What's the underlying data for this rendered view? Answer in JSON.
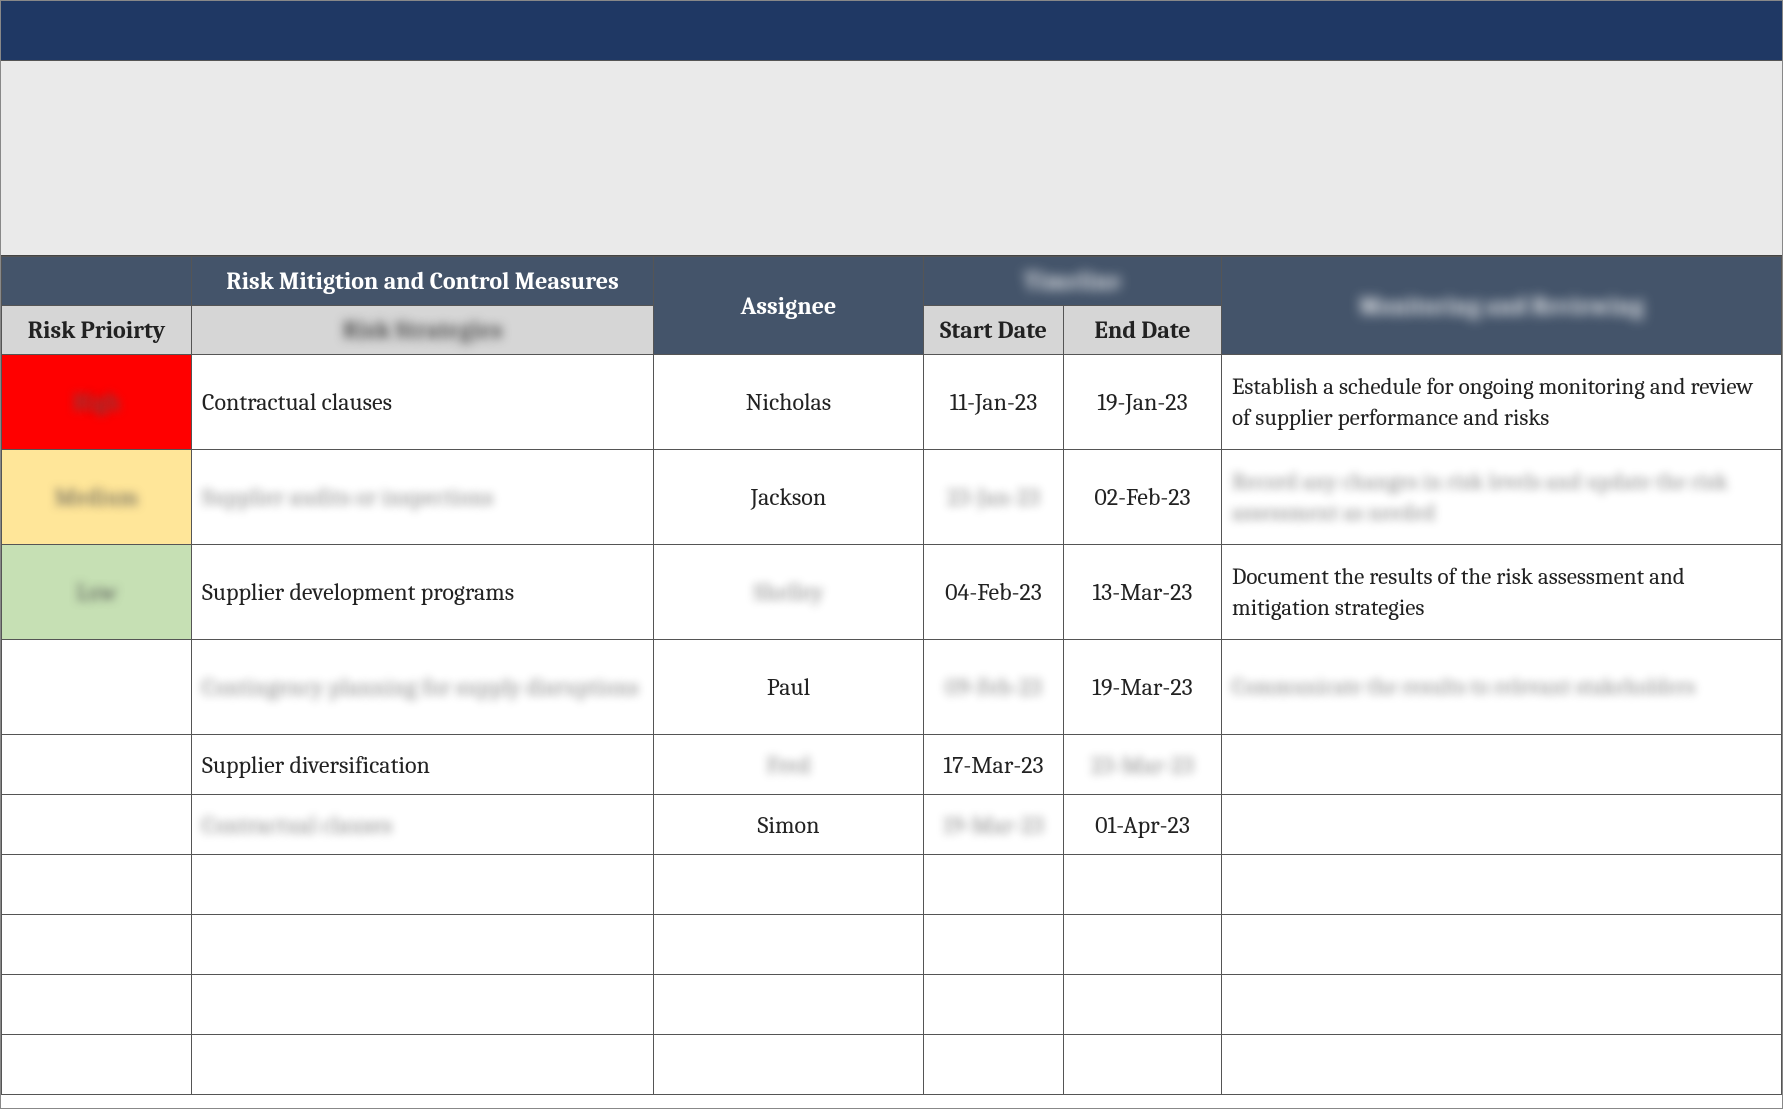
{
  "headers": {
    "risk_mitigation": "Risk Mitigtion and Control Measures",
    "risk_priority": "Risk Prioirty",
    "risk_strategies": "Risk Strategies",
    "assignee": "Assignee",
    "timeline": "Timeline",
    "start_date": "Start Date",
    "end_date": "End Date",
    "monitoring": "Monitoring and Reviewing"
  },
  "rows": [
    {
      "priority": "High",
      "strategy": "Contractual clauses",
      "assignee": "Nicholas",
      "start": "11-Jan-23",
      "end": "19-Jan-23",
      "monitor": "Establish a schedule for ongoing monitoring and review of supplier performance and risks"
    },
    {
      "priority": "Medium",
      "strategy": "Supplier audits or inspections",
      "assignee": "Jackson",
      "start": "23-Jan-23",
      "end": "02-Feb-23",
      "monitor": "Record any changes in risk levels and update the risk assessment as needed"
    },
    {
      "priority": "Low",
      "strategy": "Supplier development programs",
      "assignee": "Shelley",
      "start": "04-Feb-23",
      "end": "13-Mar-23",
      "monitor": "Document the results of the risk assessment and mitigation strategies"
    },
    {
      "priority": "",
      "strategy": "Contingency planning for supply disruptions",
      "assignee": "Paul",
      "start": "09-Feb-23",
      "end": "19-Mar-23",
      "monitor": "Communicate the results to relevant stakeholders"
    },
    {
      "priority": "",
      "strategy": "Supplier diversification",
      "assignee": "Fred",
      "start": "17-Mar-23",
      "end": "23-Mar-23",
      "monitor": ""
    },
    {
      "priority": "",
      "strategy": "Contractual clauses",
      "assignee": "Simon",
      "start": "19-Mar-23",
      "end": "01-Apr-23",
      "monitor": ""
    }
  ]
}
